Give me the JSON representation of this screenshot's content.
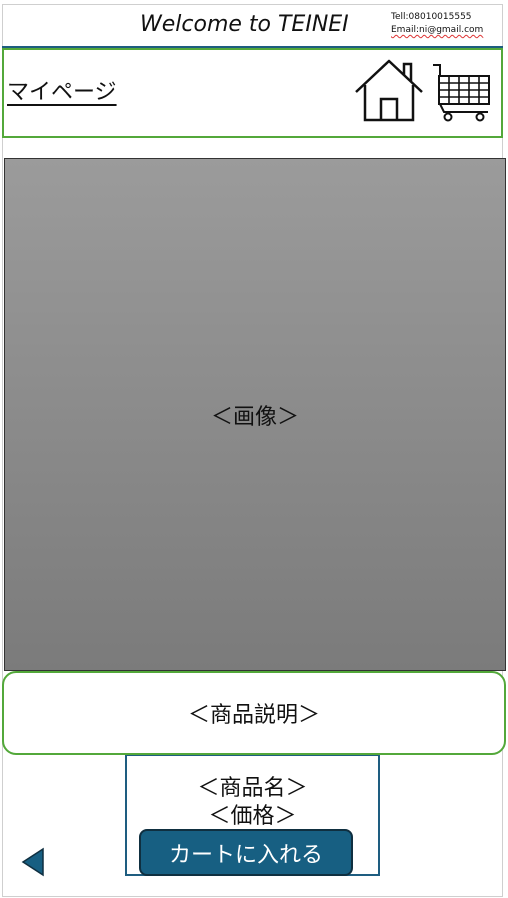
{
  "header": {
    "title": "Welcome to TEINEI",
    "tel": "Tell:08010015555",
    "email": "Email:ni@gmail.com"
  },
  "nav": {
    "mypage_label": "マイページ",
    "home_icon": "home-icon",
    "cart_icon": "cart-icon"
  },
  "product": {
    "image_placeholder": "＜画像＞",
    "description_placeholder": "＜商品説明＞",
    "name_placeholder": "＜商品名＞",
    "price_placeholder": "＜価格＞",
    "add_to_cart_label": "カートに入れる"
  },
  "footer": {
    "back_icon": "back-triangle-icon"
  },
  "colors": {
    "accent_green": "#53a83a",
    "accent_blue": "#175f82",
    "image_gray": "#8c8c8c"
  }
}
